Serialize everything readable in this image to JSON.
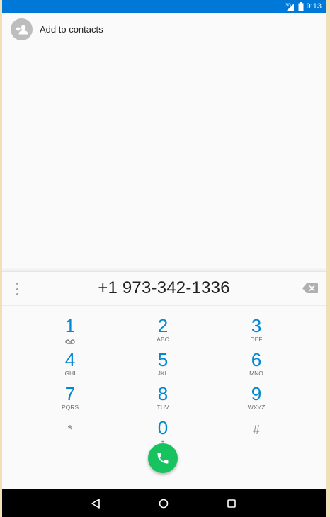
{
  "status_bar": {
    "network": "3G",
    "time": "9:13",
    "color": "#0078d7"
  },
  "contacts": {
    "add_label": "Add to contacts",
    "icon": "person-add-icon"
  },
  "dialer": {
    "number": "+1 973-342-1336",
    "keys": [
      {
        "digit": "1",
        "sub": "voicemail-icon"
      },
      {
        "digit": "2",
        "sub": "ABC"
      },
      {
        "digit": "3",
        "sub": "DEF"
      },
      {
        "digit": "4",
        "sub": "GHI"
      },
      {
        "digit": "5",
        "sub": "JKL"
      },
      {
        "digit": "6",
        "sub": "MNO"
      },
      {
        "digit": "7",
        "sub": "PQRS"
      },
      {
        "digit": "8",
        "sub": "TUV"
      },
      {
        "digit": "9",
        "sub": "WXYZ"
      },
      {
        "digit": "*",
        "sub": ""
      },
      {
        "digit": "0",
        "sub": "+"
      },
      {
        "digit": "#",
        "sub": ""
      }
    ],
    "call_button_color": "#16c35f",
    "accent_color": "#0288d1"
  },
  "nav": {
    "back": "back-icon",
    "home": "home-icon",
    "recents": "recents-icon"
  }
}
